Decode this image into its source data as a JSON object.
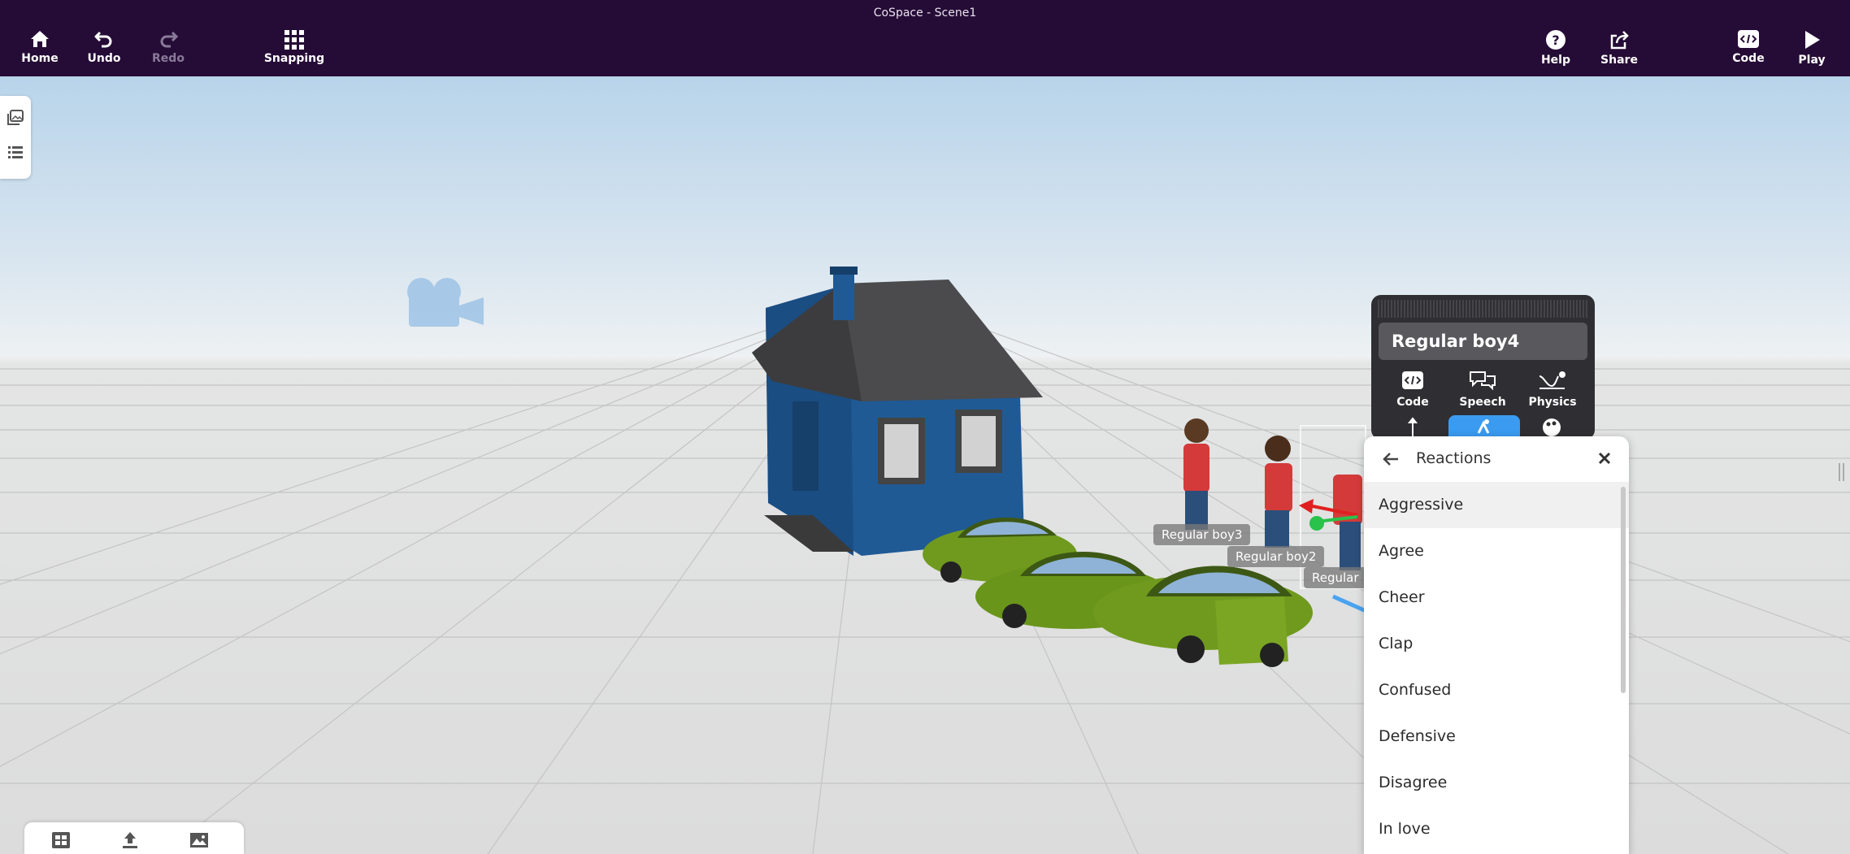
{
  "app": {
    "window_title": "CoSpace - Scene1"
  },
  "toolbar": {
    "home": "Home",
    "undo": "Undo",
    "redo": "Redo",
    "snapping": "Snapping",
    "help": "Help",
    "share": "Share",
    "code": "Code",
    "play": "Play"
  },
  "scene": {
    "labels": {
      "boy3": "Regular boy3",
      "boy2": "Regular boy2",
      "boy4": "Regular"
    }
  },
  "object_panel": {
    "object_name": "Regular boy4",
    "buttons": {
      "code": "Code",
      "speech": "Speech",
      "physics": "Physics"
    }
  },
  "reactions_menu": {
    "title": "Reactions",
    "items": [
      "Aggressive",
      "Agree",
      "Cheer",
      "Clap",
      "Confused",
      "Defensive",
      "Disagree",
      "In love"
    ],
    "highlighted": "Aggressive"
  },
  "colors": {
    "topbar": "#250c36",
    "panel": "#2f2f33",
    "accent": "#3b9bf0",
    "house": "#1f5a95",
    "car": "#6f9a1e"
  }
}
